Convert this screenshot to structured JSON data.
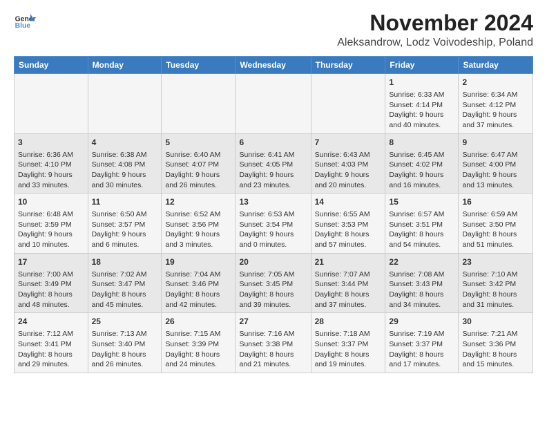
{
  "logo": {
    "general": "General",
    "blue": "Blue"
  },
  "header": {
    "title": "November 2024",
    "subtitle": "Aleksandrow, Lodz Voivodeship, Poland"
  },
  "weekdays": [
    "Sunday",
    "Monday",
    "Tuesday",
    "Wednesday",
    "Thursday",
    "Friday",
    "Saturday"
  ],
  "weeks": [
    [
      {
        "day": "",
        "detail": ""
      },
      {
        "day": "",
        "detail": ""
      },
      {
        "day": "",
        "detail": ""
      },
      {
        "day": "",
        "detail": ""
      },
      {
        "day": "",
        "detail": ""
      },
      {
        "day": "1",
        "detail": "Sunrise: 6:33 AM\nSunset: 4:14 PM\nDaylight: 9 hours and 40 minutes."
      },
      {
        "day": "2",
        "detail": "Sunrise: 6:34 AM\nSunset: 4:12 PM\nDaylight: 9 hours and 37 minutes."
      }
    ],
    [
      {
        "day": "3",
        "detail": "Sunrise: 6:36 AM\nSunset: 4:10 PM\nDaylight: 9 hours and 33 minutes."
      },
      {
        "day": "4",
        "detail": "Sunrise: 6:38 AM\nSunset: 4:08 PM\nDaylight: 9 hours and 30 minutes."
      },
      {
        "day": "5",
        "detail": "Sunrise: 6:40 AM\nSunset: 4:07 PM\nDaylight: 9 hours and 26 minutes."
      },
      {
        "day": "6",
        "detail": "Sunrise: 6:41 AM\nSunset: 4:05 PM\nDaylight: 9 hours and 23 minutes."
      },
      {
        "day": "7",
        "detail": "Sunrise: 6:43 AM\nSunset: 4:03 PM\nDaylight: 9 hours and 20 minutes."
      },
      {
        "day": "8",
        "detail": "Sunrise: 6:45 AM\nSunset: 4:02 PM\nDaylight: 9 hours and 16 minutes."
      },
      {
        "day": "9",
        "detail": "Sunrise: 6:47 AM\nSunset: 4:00 PM\nDaylight: 9 hours and 13 minutes."
      }
    ],
    [
      {
        "day": "10",
        "detail": "Sunrise: 6:48 AM\nSunset: 3:59 PM\nDaylight: 9 hours and 10 minutes."
      },
      {
        "day": "11",
        "detail": "Sunrise: 6:50 AM\nSunset: 3:57 PM\nDaylight: 9 hours and 6 minutes."
      },
      {
        "day": "12",
        "detail": "Sunrise: 6:52 AM\nSunset: 3:56 PM\nDaylight: 9 hours and 3 minutes."
      },
      {
        "day": "13",
        "detail": "Sunrise: 6:53 AM\nSunset: 3:54 PM\nDaylight: 9 hours and 0 minutes."
      },
      {
        "day": "14",
        "detail": "Sunrise: 6:55 AM\nSunset: 3:53 PM\nDaylight: 8 hours and 57 minutes."
      },
      {
        "day": "15",
        "detail": "Sunrise: 6:57 AM\nSunset: 3:51 PM\nDaylight: 8 hours and 54 minutes."
      },
      {
        "day": "16",
        "detail": "Sunrise: 6:59 AM\nSunset: 3:50 PM\nDaylight: 8 hours and 51 minutes."
      }
    ],
    [
      {
        "day": "17",
        "detail": "Sunrise: 7:00 AM\nSunset: 3:49 PM\nDaylight: 8 hours and 48 minutes."
      },
      {
        "day": "18",
        "detail": "Sunrise: 7:02 AM\nSunset: 3:47 PM\nDaylight: 8 hours and 45 minutes."
      },
      {
        "day": "19",
        "detail": "Sunrise: 7:04 AM\nSunset: 3:46 PM\nDaylight: 8 hours and 42 minutes."
      },
      {
        "day": "20",
        "detail": "Sunrise: 7:05 AM\nSunset: 3:45 PM\nDaylight: 8 hours and 39 minutes."
      },
      {
        "day": "21",
        "detail": "Sunrise: 7:07 AM\nSunset: 3:44 PM\nDaylight: 8 hours and 37 minutes."
      },
      {
        "day": "22",
        "detail": "Sunrise: 7:08 AM\nSunset: 3:43 PM\nDaylight: 8 hours and 34 minutes."
      },
      {
        "day": "23",
        "detail": "Sunrise: 7:10 AM\nSunset: 3:42 PM\nDaylight: 8 hours and 31 minutes."
      }
    ],
    [
      {
        "day": "24",
        "detail": "Sunrise: 7:12 AM\nSunset: 3:41 PM\nDaylight: 8 hours and 29 minutes."
      },
      {
        "day": "25",
        "detail": "Sunrise: 7:13 AM\nSunset: 3:40 PM\nDaylight: 8 hours and 26 minutes."
      },
      {
        "day": "26",
        "detail": "Sunrise: 7:15 AM\nSunset: 3:39 PM\nDaylight: 8 hours and 24 minutes."
      },
      {
        "day": "27",
        "detail": "Sunrise: 7:16 AM\nSunset: 3:38 PM\nDaylight: 8 hours and 21 minutes."
      },
      {
        "day": "28",
        "detail": "Sunrise: 7:18 AM\nSunset: 3:37 PM\nDaylight: 8 hours and 19 minutes."
      },
      {
        "day": "29",
        "detail": "Sunrise: 7:19 AM\nSunset: 3:37 PM\nDaylight: 8 hours and 17 minutes."
      },
      {
        "day": "30",
        "detail": "Sunrise: 7:21 AM\nSunset: 3:36 PM\nDaylight: 8 hours and 15 minutes."
      }
    ]
  ]
}
